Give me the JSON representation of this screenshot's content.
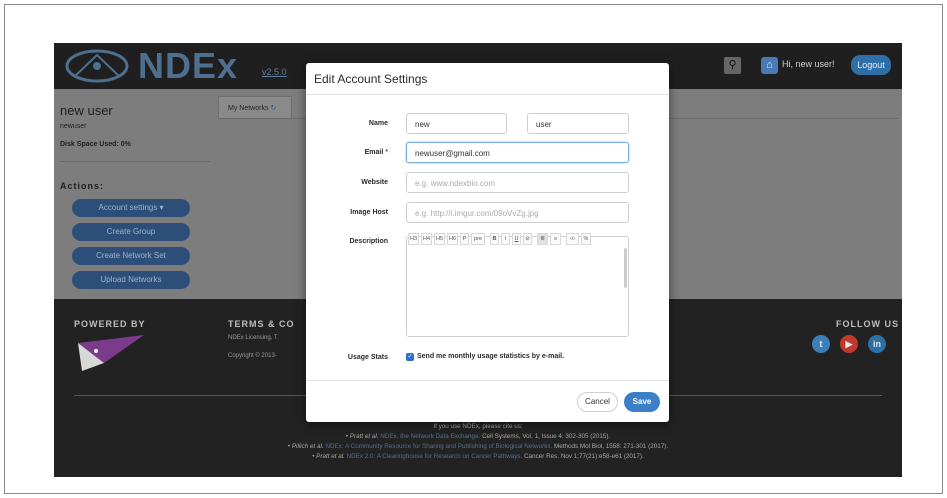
{
  "header": {
    "logo_text": "NDEx",
    "version": "v2.5.0",
    "greeting": "Hi, new user!",
    "logout_label": "Logout",
    "search_icon": "search-icon",
    "home_icon": "home-icon"
  },
  "profile": {
    "name": "new user",
    "login": "newuser",
    "disk_space": "Disk Space Used: 0%",
    "actions_label": "Actions:",
    "actions": [
      {
        "label": "Account settings ▾"
      },
      {
        "label": "Create Group"
      },
      {
        "label": "Create Network Set"
      },
      {
        "label": "Upload Networks"
      }
    ]
  },
  "tabs": {
    "my_networks": "My Networks"
  },
  "footer": {
    "powered_by": "POWERED BY",
    "terms_heading": "TERMS & CO",
    "terms_line1": "NDEx Licensing, T",
    "terms_line2": "Copyright © 2013-",
    "follow_us": "FOLLOW US",
    "cite_intro": "If you use NDEx, please cite us:",
    "citations": [
      {
        "bullet": "•",
        "author": "Pratt et al.",
        "title": "NDEx, the Network Data Exchange.",
        "ref": "Cell Systems, Vol. 1, Issue 4: 302-305 (2015)."
      },
      {
        "bullet": "•",
        "author": "Pillich et al.",
        "title": "NDEx: A Community Resource for Sharing and Publishing of Biological Networks.",
        "ref": "Methods Mol Biol, 1558: 271-301 (2017)."
      },
      {
        "bullet": "•",
        "author": "Pratt et al.",
        "title": "NDEx 2.0: A Clearinghouse for Research on Cancer Pathways.",
        "ref": "Cancer Res. Nov 1;77(21):e58-e61 (2017)."
      }
    ]
  },
  "modal": {
    "title": "Edit Account Settings",
    "fields": {
      "name_label": "Name",
      "first_name": "new",
      "last_name": "user",
      "email_label": "Email",
      "email_required": "*",
      "email_value": "newuser@gmail.com",
      "website_label": "Website",
      "website_placeholder": "e.g. www.ndexbio.com",
      "image_host_label": "Image Host",
      "image_host_placeholder": "e.g. http://i.imgur.com/09oVvZg.jpg",
      "description_label": "Description",
      "usage_label": "Usage Stats",
      "usage_checkbox": "Send me monthly usage statistics by e-mail."
    },
    "toolbar": [
      "H3",
      "H4",
      "H5",
      "H6",
      "P",
      "pre",
      "B",
      "I",
      "U",
      "⊘",
      "≣",
      "≡",
      "‹/›",
      "%"
    ],
    "cancel_label": "Cancel",
    "save_label": "Save"
  },
  "colors": {
    "accent": "#3c7fc9",
    "header_bg": "#1f1f1f",
    "footer_bg": "#222222",
    "twitter": "#3a7fb8",
    "youtube": "#c0392b",
    "linkedin": "#2a6fa5"
  }
}
